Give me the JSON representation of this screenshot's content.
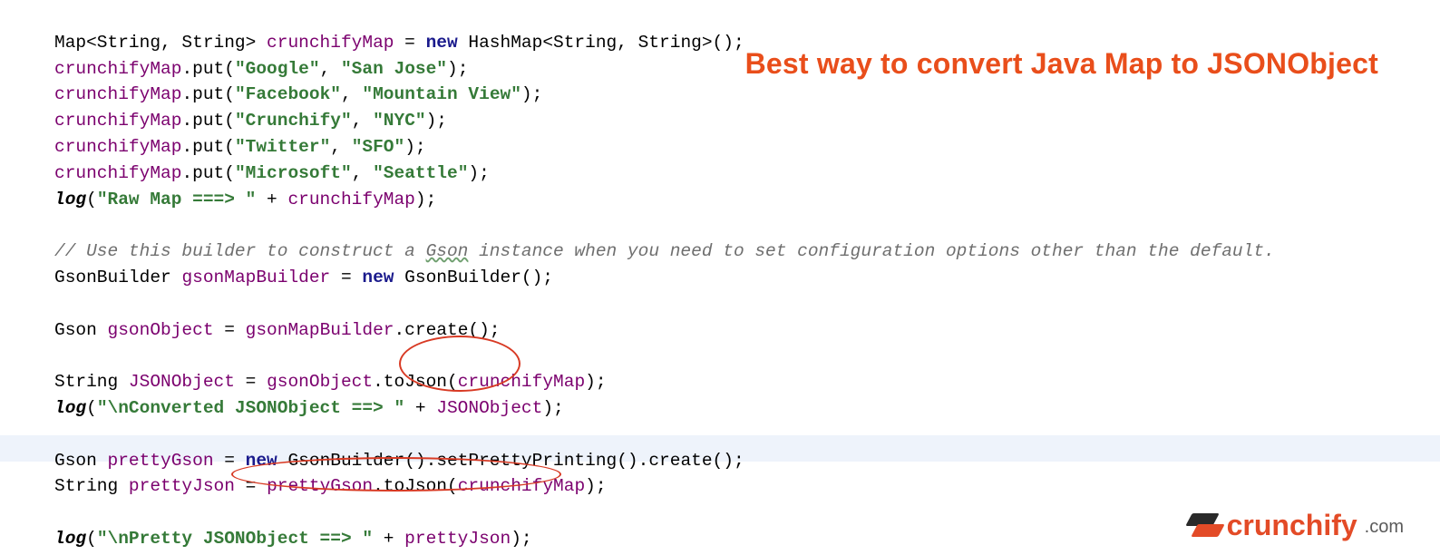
{
  "heading": "Best way to convert Java Map to JSONObject",
  "code": {
    "l1_a": "Map<String, String> ",
    "l1_b": "crunchifyMap",
    "l1_c": " = ",
    "l1_d": "new",
    "l1_e": " HashMap<String, String>();",
    "l2_a": "crunchifyMap",
    "l2_b": ".put(",
    "l2_c": "\"Google\"",
    "l2_d": ", ",
    "l2_e": "\"San Jose\"",
    "l2_f": ");",
    "l3_a": "crunchifyMap",
    "l3_b": ".put(",
    "l3_c": "\"Facebook\"",
    "l3_d": ", ",
    "l3_e": "\"Mountain View\"",
    "l3_f": ");",
    "l4_a": "crunchifyMap",
    "l4_b": ".put(",
    "l4_c": "\"Crunchify\"",
    "l4_d": ", ",
    "l4_e": "\"NYC\"",
    "l4_f": ");",
    "l5_a": "crunchifyMap",
    "l5_b": ".put(",
    "l5_c": "\"Twitter\"",
    "l5_d": ", ",
    "l5_e": "\"SFO\"",
    "l5_f": ");",
    "l6_a": "crunchifyMap",
    "l6_b": ".put(",
    "l6_c": "\"Microsoft\"",
    "l6_d": ", ",
    "l6_e": "\"Seattle\"",
    "l6_f": ");",
    "l7_a": "log",
    "l7_b": "(",
    "l7_c": "\"Raw Map ===> \"",
    "l7_d": " + ",
    "l7_e": "crunchifyMap",
    "l7_f": ");",
    "l9_a": "// Use this builder to construct a ",
    "l9_b": "Gson",
    "l9_c": " instance when you need to set configuration options other than the default.",
    "l10_a": "GsonBuilder ",
    "l10_b": "gsonMapBuilder",
    "l10_c": " = ",
    "l10_d": "new",
    "l10_e": " GsonBuilder();",
    "l12_a": "Gson ",
    "l12_b": "gsonObject",
    "l12_c": " = ",
    "l12_d": "gsonMapBuilder",
    "l12_e": ".create();",
    "l14_a": "String ",
    "l14_b": "JSONObject",
    "l14_c": " = ",
    "l14_d": "gsonObject",
    "l14_e": ".toJson(",
    "l14_f": "crunchifyMap",
    "l14_g": ");",
    "l15_a": "log",
    "l15_b": "(",
    "l15_c": "\"\\nConverted JSONObject ==> \"",
    "l15_d": " + ",
    "l15_e": "JSONObject",
    "l15_f": ");",
    "l17_a": "Gson ",
    "l17_b": "prettyGson",
    "l17_c": " = ",
    "l17_d": "new",
    "l17_e": " GsonBuilder().setPrettyPrinting().create();",
    "l18_a": "String ",
    "l18_b": "prettyJson",
    "l18_c": " = ",
    "l18_d": "prettyGson",
    "l18_e": ".toJson(",
    "l18_f": "crunchifyMap",
    "l18_g": ");",
    "l20_a": "log",
    "l20_b": "(",
    "l20_c": "\"\\nPretty JSONObject ==> \"",
    "l20_d": " + ",
    "l20_e": "prettyJson",
    "l20_f": ");"
  },
  "logo": {
    "brand": "crunchify",
    "suffix": ".com"
  }
}
